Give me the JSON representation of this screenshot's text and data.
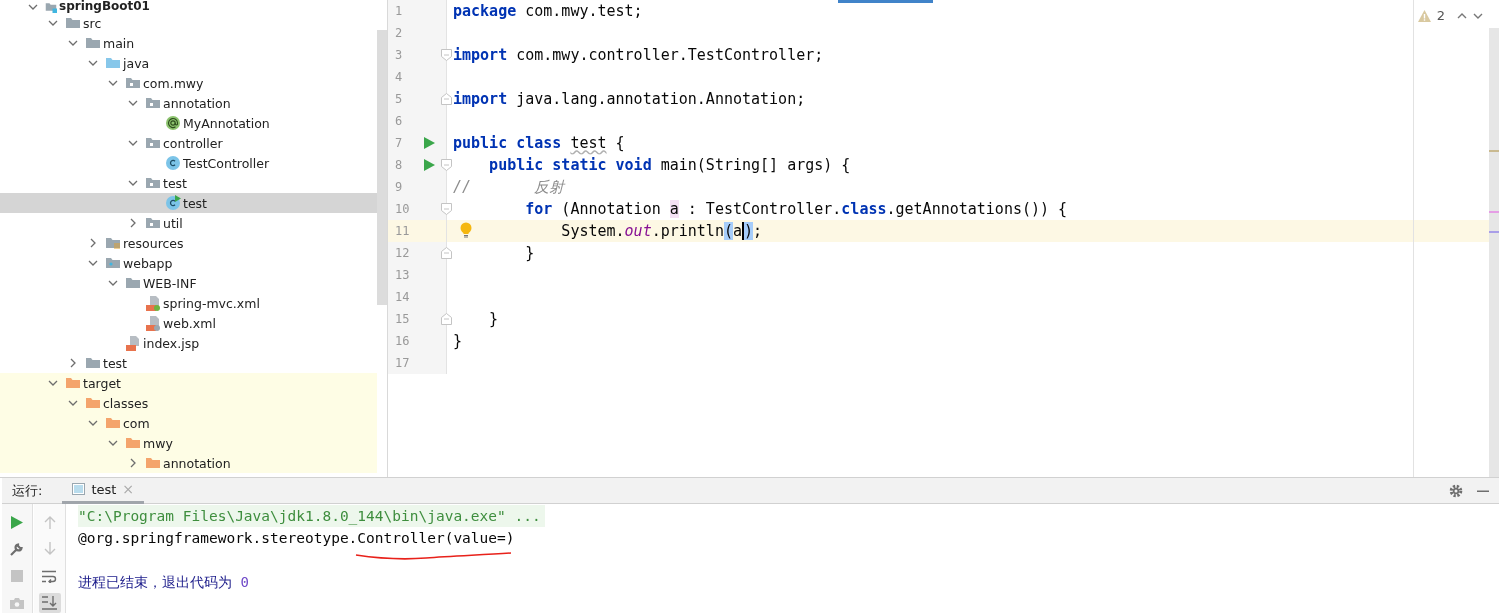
{
  "project_tree": [
    {
      "label": "springBoot01",
      "kind": "module",
      "expanded": true,
      "selected": false,
      "root": true,
      "children": [
        {
          "label": "src",
          "kind": "folder",
          "expanded": true,
          "selected": false,
          "excluded": false,
          "children": [
            {
              "label": "main",
              "kind": "folder",
              "expanded": true,
              "selected": false,
              "children": [
                {
                  "label": "java",
                  "kind": "source-folder",
                  "expanded": true,
                  "selected": false,
                  "children": [
                    {
                      "label": "com.mwy",
                      "kind": "package",
                      "expanded": true,
                      "selected": false,
                      "children": [
                        {
                          "label": "annotation",
                          "kind": "package",
                          "expanded": true,
                          "selected": false,
                          "children": [
                            {
                              "label": "MyAnnotation",
                              "kind": "annotation",
                              "selected": false
                            }
                          ]
                        },
                        {
                          "label": "controller",
                          "kind": "package",
                          "expanded": true,
                          "selected": false,
                          "children": [
                            {
                              "label": "TestController",
                              "kind": "class",
                              "selected": false
                            }
                          ]
                        },
                        {
                          "label": "test",
                          "kind": "package",
                          "expanded": true,
                          "selected": false,
                          "children": [
                            {
                              "label": "test",
                              "kind": "runnable-class",
                              "selected": true
                            }
                          ]
                        },
                        {
                          "label": "util",
                          "kind": "package",
                          "expanded": false,
                          "selected": false
                        }
                      ]
                    }
                  ]
                },
                {
                  "label": "resources",
                  "kind": "resources",
                  "expanded": false,
                  "selected": false
                },
                {
                  "label": "webapp",
                  "kind": "webapp",
                  "expanded": true,
                  "selected": false,
                  "children": [
                    {
                      "label": "WEB-INF",
                      "kind": "folder",
                      "expanded": true,
                      "selected": false,
                      "children": [
                        {
                          "label": "spring-mvc.xml",
                          "kind": "spring-xml",
                          "selected": false
                        },
                        {
                          "label": "web.xml",
                          "kind": "web-xml",
                          "selected": false
                        }
                      ]
                    },
                    {
                      "label": "index.jsp",
                      "kind": "jsp",
                      "selected": false
                    }
                  ]
                }
              ]
            },
            {
              "label": "test",
              "kind": "folder",
              "expanded": false,
              "selected": false
            }
          ]
        },
        {
          "label": "target",
          "kind": "excluded-folder",
          "expanded": true,
          "selected": false,
          "excluded": true,
          "children": [
            {
              "label": "classes",
              "kind": "excluded-folder",
              "expanded": true,
              "selected": false,
              "children": [
                {
                  "label": "com",
                  "kind": "excluded-folder",
                  "expanded": true,
                  "selected": false,
                  "children": [
                    {
                      "label": "mwy",
                      "kind": "excluded-folder",
                      "expanded": true,
                      "selected": false,
                      "children": [
                        {
                          "label": "annotation",
                          "kind": "excluded-folder",
                          "expanded": false,
                          "selected": false
                        }
                      ]
                    }
                  ]
                }
              ]
            }
          ]
        }
      ]
    }
  ],
  "editor": {
    "inspections": {
      "warnings": "2"
    },
    "lines": [
      {
        "number": "1",
        "current": false,
        "segments": [
          {
            "kind": "keyword",
            "text": "package"
          },
          {
            "kind": "plain",
            "text": " com.mwy.test;"
          }
        ]
      },
      {
        "number": "2",
        "current": false
      },
      {
        "number": "3",
        "current": false,
        "gutter_marks": [
          {
            "kind": "fold-start"
          }
        ],
        "segments": [
          {
            "kind": "keyword",
            "text": "import"
          },
          {
            "kind": "plain",
            "text": " com.mwy.controller.TestController;"
          }
        ]
      },
      {
        "number": "4",
        "current": false
      },
      {
        "number": "5",
        "current": false,
        "gutter_marks": [
          {
            "kind": "fold-end"
          }
        ],
        "segments": [
          {
            "kind": "keyword",
            "text": "import"
          },
          {
            "kind": "plain",
            "text": " java.lang.annotation.Annotation;"
          }
        ]
      },
      {
        "number": "6",
        "current": false
      },
      {
        "number": "7",
        "current": false,
        "gutter_marks": [
          {
            "kind": "run"
          }
        ],
        "segments": [
          {
            "kind": "keyword",
            "text": "public class "
          },
          {
            "kind": "typo",
            "text": "test"
          },
          {
            "kind": "plain",
            "text": " {"
          }
        ]
      },
      {
        "number": "8",
        "current": false,
        "gutter_marks": [
          {
            "kind": "run"
          },
          {
            "kind": "fold-start"
          }
        ],
        "segments": [
          {
            "kind": "keyword",
            "text": "    public static void"
          },
          {
            "kind": "plain",
            "text": " main(String[] args) {"
          }
        ]
      },
      {
        "number": "9",
        "current": false,
        "segments": [
          {
            "kind": "comment",
            "text": "//       反射"
          }
        ]
      },
      {
        "number": "10",
        "current": false,
        "gutter_marks": [
          {
            "kind": "fold-start"
          }
        ],
        "segments": [
          {
            "kind": "keyword",
            "text": "        for"
          },
          {
            "kind": "plain",
            "text": " (Annotation "
          },
          {
            "kind": "usage",
            "text": "a"
          },
          {
            "kind": "plain",
            "text": " : TestController."
          },
          {
            "kind": "keyword",
            "text": "class"
          },
          {
            "kind": "plain",
            "text": ".getAnnotations()) {"
          }
        ]
      },
      {
        "number": "11",
        "current": true,
        "gutter_marks": [
          {
            "kind": "bulb"
          }
        ],
        "segments": [
          {
            "kind": "plain",
            "text": "            System."
          },
          {
            "kind": "static-field",
            "text": "out"
          },
          {
            "kind": "plain",
            "text": ".println"
          },
          {
            "kind": "brace",
            "text": "("
          },
          {
            "kind": "plain",
            "text": "a"
          },
          {
            "kind": "brace-caret",
            "text": ")"
          },
          {
            "kind": "plain",
            "text": ";"
          }
        ]
      },
      {
        "number": "12",
        "current": false,
        "gutter_marks": [
          {
            "kind": "fold-end"
          }
        ],
        "segments": [
          {
            "kind": "plain",
            "text": "        }"
          }
        ]
      },
      {
        "number": "13",
        "current": false
      },
      {
        "number": "14",
        "current": false
      },
      {
        "number": "15",
        "current": false,
        "gutter_marks": [
          {
            "kind": "fold-end"
          }
        ],
        "segments": [
          {
            "kind": "plain",
            "text": "    }"
          }
        ]
      },
      {
        "number": "16",
        "current": false,
        "segments": [
          {
            "kind": "plain",
            "text": "}"
          }
        ]
      },
      {
        "number": "17",
        "current": false
      }
    ]
  },
  "run_panel": {
    "label": "运行:",
    "tabs": [
      {
        "title": "test",
        "close": "×",
        "selected": true
      }
    ],
    "toolbar": [
      {
        "kind": "rerun",
        "disabled": false
      },
      {
        "kind": "wrench",
        "disabled": false
      },
      {
        "kind": "stop",
        "disabled": true
      },
      {
        "kind": "camera",
        "disabled": true
      }
    ],
    "console_toolbar": [
      {
        "kind": "up",
        "disabled": true,
        "selected": false
      },
      {
        "kind": "down",
        "disabled": true,
        "selected": false
      },
      {
        "kind": "soft-wrap",
        "disabled": false,
        "selected": false
      },
      {
        "kind": "scroll-to-end",
        "disabled": false,
        "selected": true
      }
    ],
    "console": [
      {
        "kind": "command",
        "segments": [
          {
            "kind": "plain",
            "text": "\"C:\\Program Files\\Java\\jdk1.8.0_144\\bin\\java.exe\" ..."
          }
        ]
      },
      {
        "kind": "output",
        "segments": [
          {
            "kind": "plain",
            "text": "@org.springframework.stereotype."
          },
          {
            "kind": "underlined",
            "text": "Controller(value=)"
          }
        ]
      },
      {
        "kind": "exit",
        "segments": [
          {
            "kind": "plain",
            "text": "进程已结束，退出代码为 "
          },
          {
            "kind": "number",
            "text": "0"
          }
        ]
      }
    ]
  }
}
